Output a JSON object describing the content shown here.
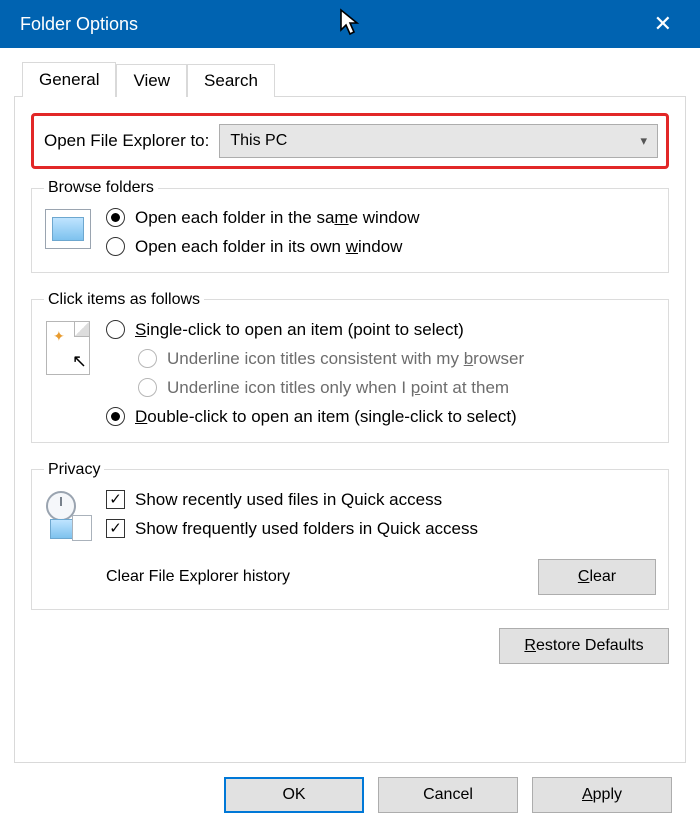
{
  "window": {
    "title": "Folder Options",
    "close_glyph": "✕"
  },
  "tabs": {
    "general": "General",
    "view": "View",
    "search": "Search"
  },
  "open_explorer": {
    "label": "Open File Explorer to:",
    "value": "This PC"
  },
  "browse": {
    "legend": "Browse folders",
    "same_pre": "Open each folder in the sa",
    "same_u": "m",
    "same_post": "e window",
    "own_pre": "Open each folder in its own ",
    "own_u": "w",
    "own_post": "indow",
    "selected": "same"
  },
  "click": {
    "legend": "Click items as follows",
    "single_u": "S",
    "single_post": "ingle-click to open an item (point to select)",
    "uline_browser_pre": "Underline icon titles consistent with my ",
    "uline_browser_u": "b",
    "uline_browser_post": "rowser",
    "uline_point_pre": "Underline icon titles only when I ",
    "uline_point_u": "p",
    "uline_point_post": "oint at them",
    "double_u": "D",
    "double_post": "ouble-click to open an item (single-click to select)",
    "selected": "double"
  },
  "privacy": {
    "legend": "Privacy",
    "recent_files": "Show recently used files in Quick access",
    "frequent_folders": "Show frequently used folders in Quick access",
    "clear_label": "Clear File Explorer history",
    "clear_btn_u": "C",
    "clear_btn_post": "lear",
    "recent_files_checked": true,
    "frequent_folders_checked": true
  },
  "restore_u": "R",
  "restore_post": "estore Defaults",
  "buttons": {
    "ok": "OK",
    "cancel": "Cancel",
    "apply_u": "A",
    "apply_post": "pply"
  }
}
